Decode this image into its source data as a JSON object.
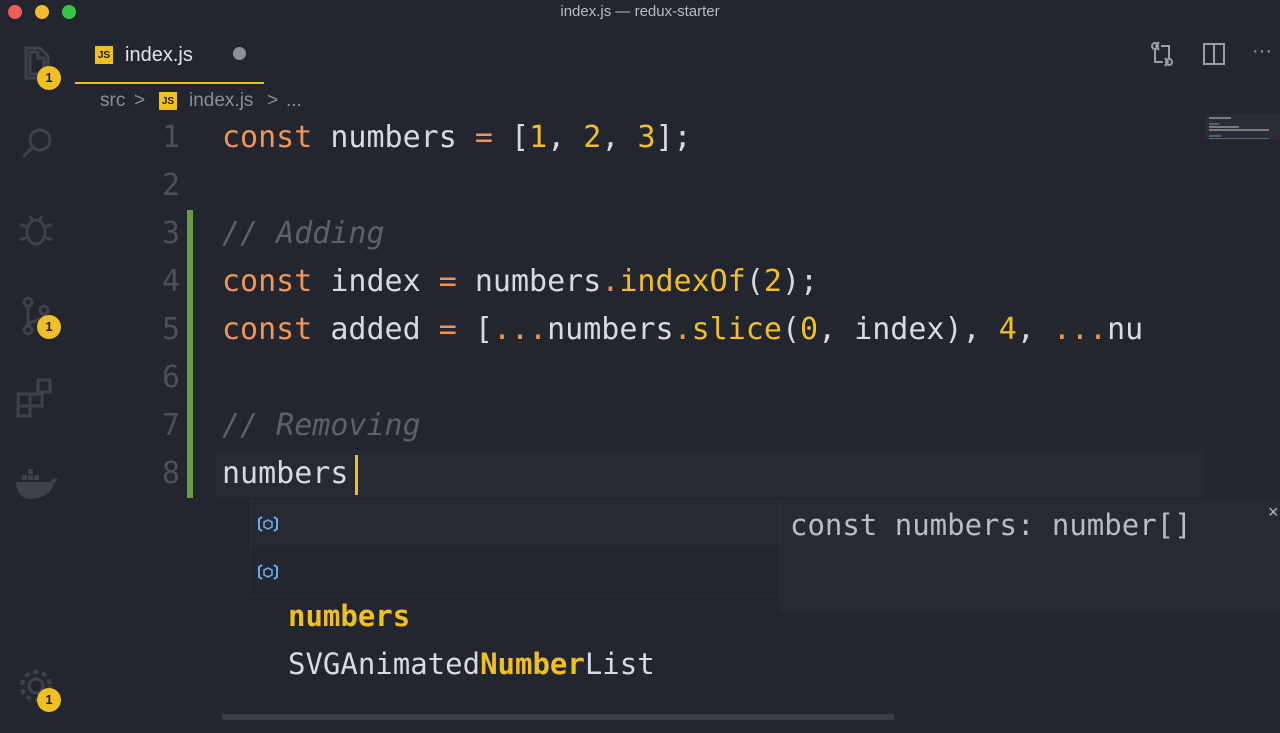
{
  "window": {
    "title": "index.js — redux-starter"
  },
  "activity_bar": {
    "items": [
      {
        "name": "explorer",
        "icon": "files-icon",
        "badge": "1"
      },
      {
        "name": "search",
        "icon": "search-icon",
        "badge": ""
      },
      {
        "name": "debug",
        "icon": "bug-icon",
        "badge": ""
      },
      {
        "name": "source-control",
        "icon": "git-branch-icon",
        "badge": "1"
      },
      {
        "name": "extensions",
        "icon": "extensions-icon",
        "badge": ""
      },
      {
        "name": "docker",
        "icon": "docker-icon",
        "badge": ""
      }
    ],
    "settings": {
      "icon": "gear-icon",
      "badge": "1"
    }
  },
  "tab": {
    "label": "index.js",
    "icon_text": "JS",
    "modified": true
  },
  "toolbar_icons": [
    "compare-changes-icon",
    "split-editor-icon",
    "more-icon"
  ],
  "toolbar": {
    "more": "···"
  },
  "breadcrumb": {
    "folder": "src",
    "sep": ">",
    "file": "index.js",
    "ellipsis": "..."
  },
  "lines": {
    "n1": "1",
    "n2": "2",
    "n3": "3",
    "n4": "4",
    "n5": "5",
    "n6": "6",
    "n7": "7",
    "n8": "8",
    "l1": {
      "kw": "const",
      "name": " numbers ",
      "op": "=",
      "open": " [",
      "a": "1",
      "c1": ", ",
      "b": "2",
      "c2": ", ",
      "c": "3",
      "close": "];"
    },
    "l3": "// Adding",
    "l4": {
      "kw": "const",
      "name": " index ",
      "op": "=",
      "obj": " numbers",
      "dot": ".",
      "fn": "indexOf",
      "open": "(",
      "arg": "2",
      "close": ");"
    },
    "l5": {
      "kw": "const",
      "name": " added ",
      "op": "=",
      "open": " [",
      "spread1": "...",
      "obj": "numbers",
      "dot": ".",
      "fn": "slice",
      "p1": "(",
      "zero": "0",
      "rest": ", index), ",
      "four": "4",
      "comma": ", ",
      "spread2": "...",
      "tail": "nu"
    },
    "l7": "// Removing",
    "l8": "numbers"
  },
  "suggest": {
    "items": [
      {
        "icon": "variable-icon",
        "text": "numbers",
        "highlight": "",
        "rest": ""
      },
      {
        "icon": "variable-icon",
        "text": "SVGAnimated",
        "highlight": "Number",
        "rest": "List"
      }
    ],
    "detail": "const numbers: number[]",
    "close": "×"
  },
  "colors": {
    "accent": "#f0bf26",
    "keyword": "#f09455",
    "background": "#23262e",
    "gutter_change": "#6a9a4a"
  }
}
